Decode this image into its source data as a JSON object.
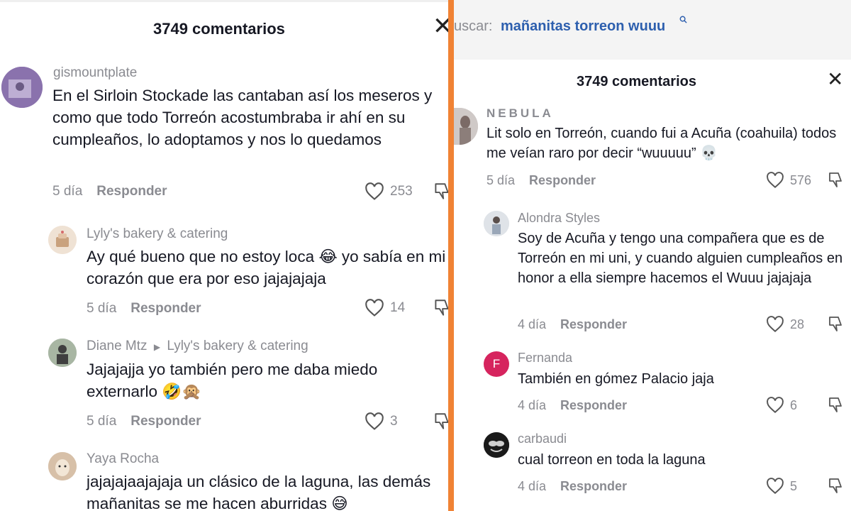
{
  "left": {
    "title": "3749 comentarios",
    "comments": [
      {
        "user": "gismountplate",
        "text": "En el Sirloin Stockade las cantaban así los meseros y como que todo Torreón acostumbraba ir ahí en su cumpleaños, lo adoptamos y nos lo quedamos",
        "age": "5 día",
        "reply": "Responder",
        "likes": "253"
      },
      {
        "user": "Lyly's bakery & catering",
        "text": "Ay qué bueno que no estoy loca 😂 yo sabía en mi corazón que era por eso jajajajaja",
        "age": "5 día",
        "reply": "Responder",
        "likes": "14"
      },
      {
        "user": "Diane Mtz",
        "reply_to": "Lyly's bakery & catering",
        "text": "Jajajajja yo también pero me daba miedo externarlo 🤣🙊",
        "age": "5 día",
        "reply": "Responder",
        "likes": "3"
      },
      {
        "user": "Yaya Rocha",
        "text": "jajajajaajajaja un clásico de la laguna, las demás mañanitas se me hacen aburridas 😅"
      }
    ]
  },
  "right": {
    "search": {
      "prefix": "uscar:",
      "query": "mañanitas torreon wuuu"
    },
    "title": "3749 comentarios",
    "comments": [
      {
        "user": "NEBULA",
        "text": "Lit solo en Torreón, cuando fui a Acuña (coahuila) todos me veían raro por decir “wuuuuu” 💀",
        "age": "5 día",
        "reply": "Responder",
        "likes": "576"
      },
      {
        "user": "Alondra Styles",
        "text": "Soy de Acuña y tengo una compañera que es de Torreón en mi uni, y cuando alguien cumpleaños en honor a ella siempre hacemos el Wuuu jajajaja",
        "age": "4 día",
        "reply": "Responder",
        "likes": "28"
      },
      {
        "user": "Fernanda",
        "initial": "F",
        "text": "También en gómez Palacio jaja",
        "age": "4 día",
        "reply": "Responder",
        "likes": "6"
      },
      {
        "user": "carbaudi",
        "text": "cual torreon en toda la laguna",
        "age": "4 día",
        "reply": "Responder",
        "likes": "5"
      }
    ]
  },
  "colors": {
    "divider": "#f08234",
    "search_query": "#2d5fae",
    "fernanda_avatar": "#d6245e"
  }
}
